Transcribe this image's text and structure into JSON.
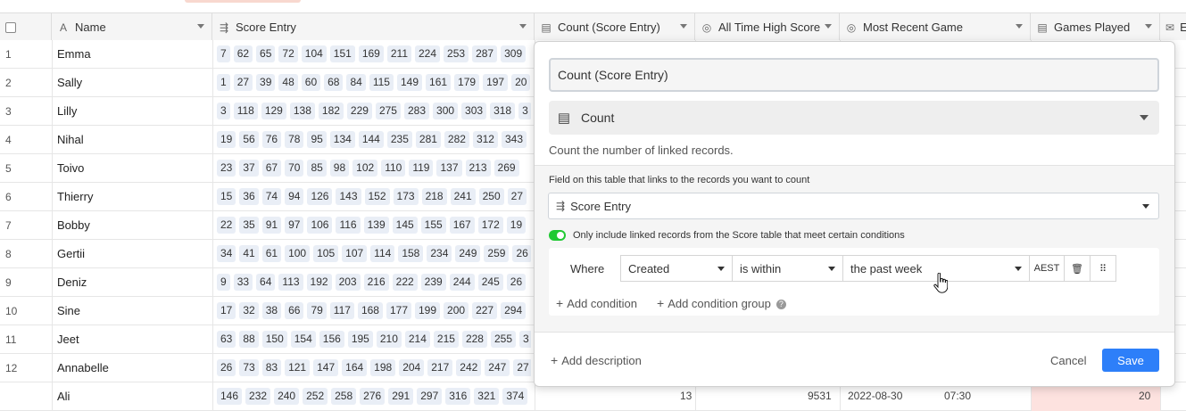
{
  "header": {
    "columns": [
      {
        "label": "Name",
        "icon": "A"
      },
      {
        "label": "Score Entry",
        "icon": "linked-record-icon"
      },
      {
        "label": "Count (Score Entry)",
        "icon": "count-icon"
      },
      {
        "label": "All Time High Score",
        "icon": "rollup-icon"
      },
      {
        "label": "Most Recent Game",
        "icon": "rollup-icon"
      },
      {
        "label": "Games Played",
        "icon": "count-icon"
      },
      {
        "label": "E",
        "icon": "email-icon"
      }
    ]
  },
  "rows": [
    {
      "num": "1",
      "name": "Emma",
      "scores": [
        "7",
        "62",
        "65",
        "72",
        "104",
        "151",
        "169",
        "211",
        "224",
        "253",
        "287",
        "309"
      ]
    },
    {
      "num": "2",
      "name": "Sally",
      "scores": [
        "1",
        "27",
        "39",
        "48",
        "60",
        "68",
        "84",
        "115",
        "149",
        "161",
        "179",
        "197",
        "20"
      ]
    },
    {
      "num": "3",
      "name": "Lilly",
      "scores": [
        "3",
        "118",
        "129",
        "138",
        "182",
        "229",
        "275",
        "283",
        "300",
        "303",
        "318",
        "3"
      ]
    },
    {
      "num": "4",
      "name": "Nihal",
      "scores": [
        "19",
        "56",
        "76",
        "78",
        "95",
        "134",
        "144",
        "235",
        "281",
        "282",
        "312",
        "343"
      ]
    },
    {
      "num": "5",
      "name": "Toivo",
      "scores": [
        "23",
        "37",
        "67",
        "70",
        "85",
        "98",
        "102",
        "110",
        "119",
        "137",
        "213",
        "269"
      ]
    },
    {
      "num": "6",
      "name": "Thierry",
      "scores": [
        "15",
        "36",
        "74",
        "94",
        "126",
        "143",
        "152",
        "173",
        "218",
        "241",
        "250",
        "27"
      ]
    },
    {
      "num": "7",
      "name": "Bobby",
      "scores": [
        "22",
        "35",
        "91",
        "97",
        "106",
        "116",
        "139",
        "145",
        "155",
        "167",
        "172",
        "19"
      ]
    },
    {
      "num": "8",
      "name": "Gertii",
      "scores": [
        "34",
        "41",
        "61",
        "100",
        "105",
        "107",
        "114",
        "158",
        "234",
        "249",
        "259",
        "26"
      ]
    },
    {
      "num": "9",
      "name": "Deniz",
      "scores": [
        "9",
        "33",
        "64",
        "113",
        "192",
        "203",
        "216",
        "222",
        "239",
        "244",
        "245",
        "26"
      ]
    },
    {
      "num": "10",
      "name": "Sine",
      "scores": [
        "17",
        "32",
        "38",
        "66",
        "79",
        "117",
        "168",
        "177",
        "199",
        "200",
        "227",
        "294"
      ]
    },
    {
      "num": "11",
      "name": "Jeet",
      "scores": [
        "63",
        "88",
        "150",
        "154",
        "156",
        "195",
        "210",
        "214",
        "215",
        "228",
        "255",
        "3"
      ]
    },
    {
      "num": "12",
      "name": "Annabelle",
      "scores": [
        "26",
        "73",
        "83",
        "121",
        "147",
        "164",
        "198",
        "204",
        "217",
        "242",
        "247",
        "27"
      ]
    },
    {
      "num": "",
      "name": "Ali",
      "scores": [
        "146",
        "232",
        "240",
        "252",
        "258",
        "276",
        "291",
        "297",
        "316",
        "321",
        "374"
      ],
      "partial": {
        "count": "13",
        "high": "9531",
        "date": "2022-08-30",
        "time": "07:30",
        "played": "20"
      }
    }
  ],
  "popup": {
    "field_name": "Count (Score Entry)",
    "field_type": "Count",
    "type_description": "Count the number of linked records.",
    "link_label": "Field on this table that links to the records you want to count",
    "link_field": "Score Entry",
    "toggle_label": "Only include linked records from the Score table that meet certain conditions",
    "toggle_on": true,
    "condition": {
      "where": "Where",
      "field": "Created",
      "operator": "is within",
      "value": "the past week",
      "timezone": "AEST"
    },
    "add_condition": "Add condition",
    "add_condition_group": "Add condition group",
    "add_description": "Add description",
    "cancel": "Cancel",
    "save": "Save"
  },
  "colors": {
    "accent": "#2d7ff9",
    "toggle": "#20c933",
    "chip": "#e9eef6",
    "highlight": "#fde2df"
  }
}
